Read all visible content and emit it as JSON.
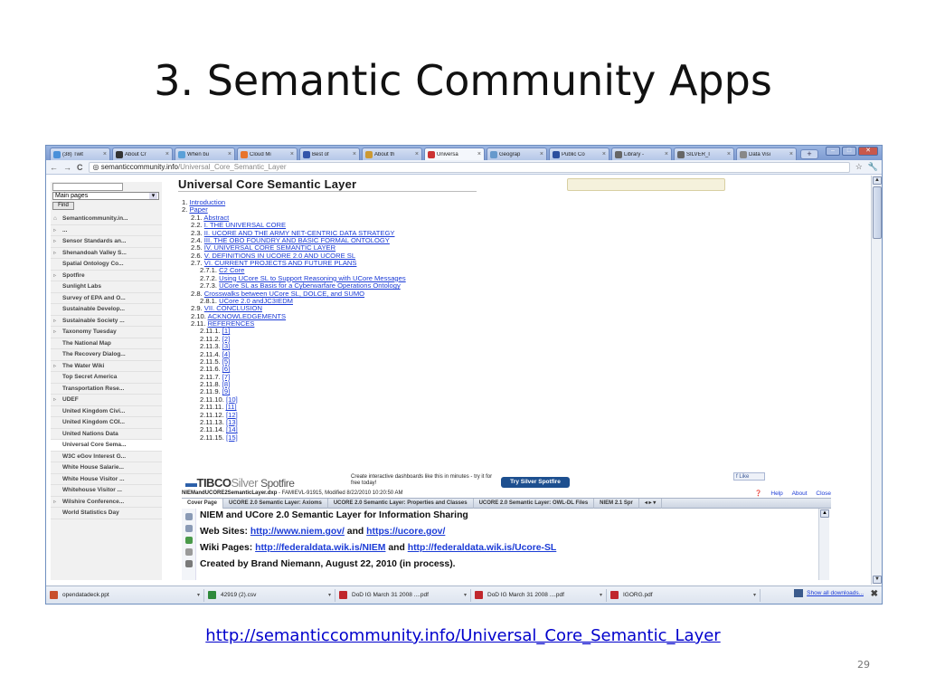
{
  "slide": {
    "title": "3. Semantic Community Apps",
    "footer_link": "http://semanticcommunity.info/Universal_Core_Semantic_Layer",
    "page_number": "29"
  },
  "browser": {
    "tabs": [
      {
        "label": "(38) Twit",
        "icon_color": "#4a90d9"
      },
      {
        "label": "About Cr",
        "icon_color": "#333333"
      },
      {
        "label": "When bu",
        "icon_color": "#5aa0d8"
      },
      {
        "label": "Cloud Mi",
        "icon_color": "#e8742c"
      },
      {
        "label": "Best of",
        "icon_color": "#3355aa"
      },
      {
        "label": "About th",
        "icon_color": "#cc9933"
      },
      {
        "label": "Universa",
        "icon_color": "#cc3333",
        "active": true
      },
      {
        "label": "Geograp",
        "icon_color": "#6699cc"
      },
      {
        "label": "Public Co",
        "icon_color": "#2b4f9e"
      },
      {
        "label": "Library -",
        "icon_color": "#666666"
      },
      {
        "label": "SILVER_I",
        "icon_color": "#666666"
      },
      {
        "label": "Data Visi",
        "icon_color": "#888888"
      }
    ],
    "address": {
      "domain": "semanticcommunity.info",
      "path": "/Universal_Core_Semantic_Layer"
    },
    "sidebar": {
      "select_value": "Main pages",
      "find_label": "Find",
      "items": [
        {
          "label": "Semanticommunity.in...",
          "arrow": "⌂"
        },
        {
          "label": "...",
          "arrow": "▹"
        },
        {
          "label": "Sensor Standards an...",
          "arrow": "▹"
        },
        {
          "label": "Shenandoah Valley S...",
          "arrow": "▹"
        },
        {
          "label": "Spatial Ontology Co...",
          "arrow": ""
        },
        {
          "label": "Spotfire",
          "arrow": "▹"
        },
        {
          "label": "Sunlight Labs",
          "arrow": ""
        },
        {
          "label": "Survey of EPA and O...",
          "arrow": ""
        },
        {
          "label": "Sustainable Develop...",
          "arrow": ""
        },
        {
          "label": "Sustainable Society ...",
          "arrow": "▹"
        },
        {
          "label": "Taxonomy Tuesday",
          "arrow": "▹"
        },
        {
          "label": "The National Map",
          "arrow": ""
        },
        {
          "label": "The Recovery Dialog...",
          "arrow": ""
        },
        {
          "label": "The Water Wiki",
          "arrow": "▹"
        },
        {
          "label": "Top Secret America",
          "arrow": ""
        },
        {
          "label": "Transportation Rese...",
          "arrow": ""
        },
        {
          "label": "UDEF",
          "arrow": "▹"
        },
        {
          "label": "United Kingdom Civi...",
          "arrow": ""
        },
        {
          "label": "United Kingdom COI...",
          "arrow": ""
        },
        {
          "label": "United Nations Data",
          "arrow": ""
        },
        {
          "label": "Universal Core Sema...",
          "arrow": "",
          "current": true
        },
        {
          "label": "W3C eGov Interest G...",
          "arrow": ""
        },
        {
          "label": "White House Salarie...",
          "arrow": ""
        },
        {
          "label": "White House Visitor ...",
          "arrow": ""
        },
        {
          "label": "Whitehouse Visitor ...",
          "arrow": ""
        },
        {
          "label": "Wilshire Conference...",
          "arrow": "▹"
        },
        {
          "label": "World Statistics Day",
          "arrow": ""
        }
      ]
    },
    "page": {
      "heading": "Universal Core Semantic Layer",
      "toc": [
        {
          "indent": 0,
          "num": "1.",
          "text": "Introduction"
        },
        {
          "indent": 0,
          "num": "2.",
          "text": "Paper"
        },
        {
          "indent": 1,
          "num": "2.1.",
          "text": "Abstract"
        },
        {
          "indent": 1,
          "num": "2.2.",
          "text": "I. THE UNIVERSAL CORE"
        },
        {
          "indent": 1,
          "num": "2.3.",
          "text": "II. UCORE AND THE ARMY NET-CENTRIC DATA STRATEGY"
        },
        {
          "indent": 1,
          "num": "2.4.",
          "text": "III. THE OBO FOUNDRY AND BASIC FORMAL ONTOLOGY"
        },
        {
          "indent": 1,
          "num": "2.5.",
          "text": "IV. UNIVERSAL CORE SEMANTIC LAYER"
        },
        {
          "indent": 1,
          "num": "2.6.",
          "text": "V. DEFINITIONS IN UCORE 2.0 AND UCORE SL"
        },
        {
          "indent": 1,
          "num": "2.7.",
          "text": "VI. CURRENT PROJECTS AND FUTURE PLANS"
        },
        {
          "indent": 2,
          "num": "2.7.1.",
          "text": "C2 Core"
        },
        {
          "indent": 2,
          "num": "2.7.2.",
          "text": "Using UCore SL to Support Reasoning with UCore Messages"
        },
        {
          "indent": 2,
          "num": "2.7.3.",
          "text": "UCore SL as Basis for a Cyberwarfare Operations Ontology"
        },
        {
          "indent": 1,
          "num": "2.8.",
          "text": "Crosswalks between UCore SL, DOLCE, and SUMO"
        },
        {
          "indent": 2,
          "num": "2.8.1.",
          "text": "UCore 2.0 andJC3IEDM"
        },
        {
          "indent": 1,
          "num": "2.9.",
          "text": "VII. CONCLUSION"
        },
        {
          "indent": 1,
          "num": "2.10.",
          "text": "ACKNOWLEDGEMENTS"
        },
        {
          "indent": 1,
          "num": "2.11.",
          "text": "REFERENCES"
        },
        {
          "indent": 2,
          "num": "2.11.1.",
          "text": "[1]"
        },
        {
          "indent": 2,
          "num": "2.11.2.",
          "text": "[2]"
        },
        {
          "indent": 2,
          "num": "2.11.3.",
          "text": "[3]"
        },
        {
          "indent": 2,
          "num": "2.11.4.",
          "text": "[4]"
        },
        {
          "indent": 2,
          "num": "2.11.5.",
          "text": "[5]"
        },
        {
          "indent": 2,
          "num": "2.11.6.",
          "text": "[6]"
        },
        {
          "indent": 2,
          "num": "2.11.7.",
          "text": "[7]"
        },
        {
          "indent": 2,
          "num": "2.11.8.",
          "text": "[8]"
        },
        {
          "indent": 2,
          "num": "2.11.9.",
          "text": "[9]"
        },
        {
          "indent": 2,
          "num": "2.11.10.",
          "text": "[10]"
        },
        {
          "indent": 2,
          "num": "2.11.11.",
          "text": "[11]"
        },
        {
          "indent": 2,
          "num": "2.11.12.",
          "text": "[12]"
        },
        {
          "indent": 2,
          "num": "2.11.13.",
          "text": "[13]"
        },
        {
          "indent": 2,
          "num": "2.11.14.",
          "text": "[14]"
        },
        {
          "indent": 2,
          "num": "2.11.15.",
          "text": "[15]"
        }
      ]
    },
    "tibco": {
      "brand": "TIBCO",
      "silver": "Silver",
      "product": "Spotfire",
      "promo": "Create interactive dashboards like this in minutes - try it for free today!",
      "button": "Try Silver Spotfire",
      "like": "Like"
    },
    "spotfire": {
      "file_name": "NIEMandUCORE2SemanticLayer.dxp",
      "file_meta": " - FAMIEVL-91915, Modified 8/22/2010 10:20:50 AM",
      "links": {
        "help": "Help",
        "about": "About",
        "close": "Close"
      },
      "tabs": [
        {
          "label": "Cover Page",
          "active": true
        },
        {
          "label": "UCORE 2.0 Semantic Layer: Axioms"
        },
        {
          "label": "UCORE 2.0 Semantic Layer: Properties and Classes"
        },
        {
          "label": "UCORE 2.0 Semantic Layer: OWL-DL Files"
        },
        {
          "label": "NIEM 2.1 Spr"
        }
      ],
      "title": "NIEM and UCore 2.0 Semantic Layer for Information Sharing",
      "web_sites_label": "Web Sites: ",
      "web_site_1": "http://www.niem.gov/",
      "and": " and ",
      "web_site_2": "https://ucore.gov/",
      "wiki_label": "Wiki Pages: ",
      "wiki_1": "http://federaldata.wik.is/NIEM",
      "wiki_2": "http://federaldata.wik.is/Ucore-SL",
      "created": "Created by Brand Niemann, August 22, 2010 (in process)."
    },
    "downloads": {
      "items": [
        {
          "name": "opendatadeck.ppt",
          "icon_color": "#c8502d",
          "width": 175
        },
        {
          "name": "42919 (2).csv",
          "icon_color": "#2f8a3c",
          "width": 145
        },
        {
          "name": "DoD IG March 31 2008 ....pdf",
          "icon_color": "#c0272d",
          "width": 150
        },
        {
          "name": "DoD IG March 31 2008 ....pdf",
          "icon_color": "#c0272d",
          "width": 150
        },
        {
          "name": "IGORG.pdf",
          "icon_color": "#c0272d",
          "width": 170
        }
      ],
      "show_all": "Show all downloads...",
      "close": "✖"
    }
  }
}
